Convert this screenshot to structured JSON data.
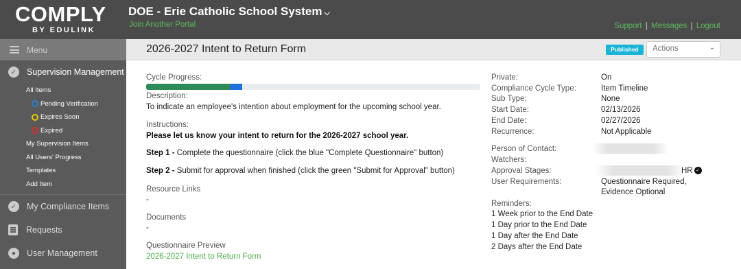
{
  "brand": {
    "logo_text": "COMPLY",
    "logo_sub": "BY EDULINK"
  },
  "header": {
    "portal_title": "DOE - Erie Catholic School System",
    "join_link": "Join Another Portal",
    "links": {
      "support": "Support",
      "messages": "Messages",
      "logout": "Logout",
      "separator": "|"
    }
  },
  "sidebar": {
    "menu_label": "Menu",
    "supervision": {
      "label": "Supervision Management",
      "items": {
        "all_items": "All Items",
        "pending": "Pending Verification",
        "expires_soon": "Expires Soon",
        "expired": "Expired",
        "my_supervision": "My Supervision Items",
        "all_users_progress": "All Users' Progress",
        "templates": "Templates",
        "add_item": "Add Item"
      }
    },
    "my_compliance": "My Compliance Items",
    "requests": "Requests",
    "user_management": "User Management"
  },
  "content_header": {
    "title": "2026-2027 Intent to Return Form",
    "status_badge": "Published",
    "actions_label": "Actions"
  },
  "form": {
    "cycle_progress_label": "Cycle Progress:",
    "progress": {
      "green_pct": 25,
      "blue_pct": 3.8
    },
    "description_label": "Description:",
    "description_text": "To indicate an employee's intention about employment for the upcoming school year.",
    "instructions_label": "Instructions:",
    "instructions_bold": "Please let us know your intent to return for the 2026-2027 school year.",
    "step1_label": "Step 1 -",
    "step1_text": " Complete the questionnaire (click the blue \"Complete Questionnaire\" button)",
    "step2_label": "Step 2 -",
    "step2_text": " Submit for approval when finished (click the green \"Submit for Approval\" button)",
    "resource_links_label": "Resource Links",
    "resource_links_value": "-",
    "documents_label": "Documents",
    "documents_value": "-",
    "questionnaire_preview_label": "Questionnaire Preview",
    "questionnaire_preview_link": "2026-2027 Intent to Return Form"
  },
  "details": {
    "private_label": "Private:",
    "private_value": "On",
    "cycle_type_label": "Compliance Cycle Type:",
    "cycle_type_value": "Item Timeline",
    "sub_type_label": "Sub Type:",
    "sub_type_value": "None",
    "start_date_label": "Start Date:",
    "start_date_value": "02/13/2026",
    "end_date_label": "End Date:",
    "end_date_value": "02/27/2026",
    "recurrence_label": "Recurrence:",
    "recurrence_value": "Not Applicable",
    "contact_label": "Person of Contact:",
    "watchers_label": "Watchers:",
    "approval_label": "Approval Stages:",
    "approval_value_suffix": "HR",
    "user_req_label": "User Requirements:",
    "user_req_line1": "Questionnaire Required,",
    "user_req_line2": "Evidence Optional",
    "reminders_label": "Reminders:",
    "reminders": [
      "1 Week prior to the End Date",
      "1 Day prior to the End Date",
      "1 Day after the End Date",
      "2 Days after the End Date"
    ]
  }
}
